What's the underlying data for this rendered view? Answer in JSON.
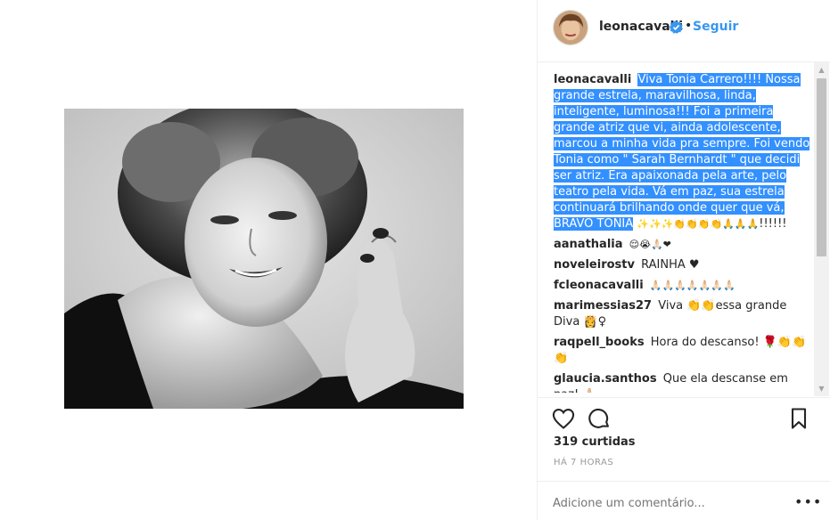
{
  "post": {
    "username": "leonacavalli",
    "follow_label": "Seguir",
    "separator": "•",
    "likes": "319 curtidas",
    "time": "HÁ 7 HORAS",
    "add_comment_placeholder": "Adicione um comentário...",
    "more_label": "•••"
  },
  "caption": {
    "user": "leonacavalli",
    "text": "Viva Tonia Carrero!!!! Nossa grande estrela, maravilhosa, linda, inteligente, luminosa!!! Foi a primeira grande atriz que vi, ainda adolescente, marcou a minha vida pra sempre. Foi vendo Tonia como \" Sarah Bernhardt \" que decidi ser atriz. Era apaixonada pela arte, pelo teatro pela vida. Vá em paz, sua estrela continuará brilhando onde quer que vá, BRAVO TÔNIA",
    "emoji": "✨✨✨👏👏👏👏🙏🙏🙏",
    "tail": "!!!!!!"
  },
  "comments": [
    {
      "user": "aanathalia",
      "text": "😌😭🙏🏻❤"
    },
    {
      "user": "noveleirostv",
      "text": "RAINHA ♥"
    },
    {
      "user": "fcleonacavalli",
      "text": "🙏🏻🙏🏻🙏🏻🙏🏻🙏🏻🙏🏻🙏🏻"
    },
    {
      "user": "marimessias27",
      "text": "Viva 👏👏essa grande Diva 👸♀"
    },
    {
      "user": "raqpell_books",
      "text": "Hora do descanso! 🌹👏👏👏"
    },
    {
      "user": "glaucia.santhos",
      "text": "Que ela descanse em paz! 🙏🏻"
    }
  ],
  "colors": {
    "link": "#3897f0",
    "selection": "#3390ff",
    "verified": "#3897f0"
  },
  "icons": [
    "heart-icon",
    "comment-icon",
    "bookmark-icon",
    "verified-icon"
  ]
}
